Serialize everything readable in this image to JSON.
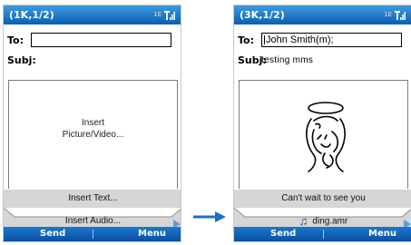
{
  "left_screen": {
    "title": "(1K,1/2)",
    "network": "1E",
    "to_label": "To:",
    "to_value": "",
    "subj_label": "Subj:",
    "subj_value": "",
    "slide_text_line1": "Insert",
    "slide_text_line2": "Picture/Video...",
    "menu_item_1": "Insert Text...",
    "menu_item_2": "Insert Audio...",
    "softkey_left": "Send",
    "softkey_right": "Menu"
  },
  "right_screen": {
    "title": "(3K,1/2)",
    "network": "1E",
    "to_label": "To:",
    "to_value": "John Smith(m);",
    "subj_label": "Subj:",
    "subj_value": "testing mms",
    "slide_caption": "Can't wait to see you",
    "audio_file": "ding.amr",
    "softkey_left": "Send",
    "softkey_right": "Menu"
  },
  "icons": {
    "signal": "signal-strength-icon",
    "next": "next-slide-arrow-icon",
    "audio": "music-note-icon",
    "transition": "right-arrow-icon"
  },
  "colors": {
    "title_bar": "#1f7fd0",
    "softkey_bar": "#0f5aa9",
    "arrow": "#1a6fd0"
  }
}
